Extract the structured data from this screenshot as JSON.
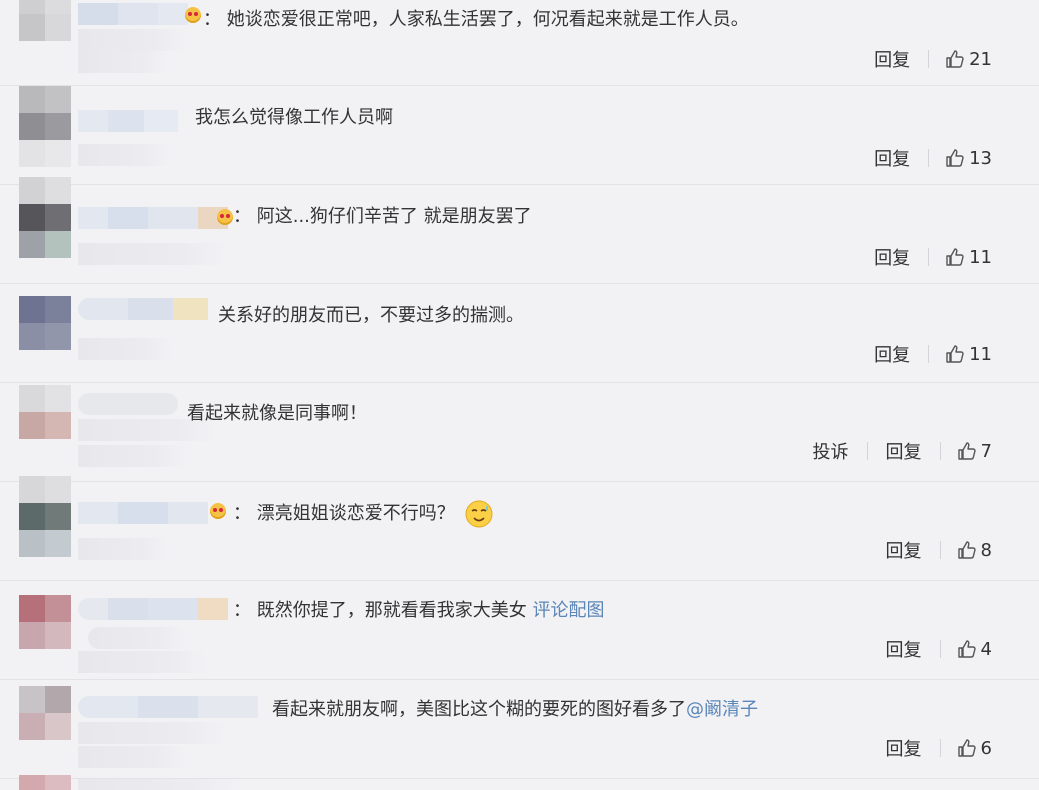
{
  "comments": [
    {
      "text": "她谈恋爱很正常吧，人家私生活罢了，何况看起来就是工作人员。",
      "actions": [
        "回复"
      ],
      "likes": "21"
    },
    {
      "text": "我怎么觉得像工作人员啊",
      "actions": [
        "回复"
      ],
      "likes": "13"
    },
    {
      "text": "阿这...狗仔们辛苦了 就是朋友罢了",
      "actions": [
        "回复"
      ],
      "likes": "11"
    },
    {
      "text": "关系好的朋友而已，不要过多的揣测。",
      "actions": [
        "回复"
      ],
      "likes": "11"
    },
    {
      "text": "看起来就像是同事啊！",
      "actions": [
        "投诉",
        "回复"
      ],
      "likes": "7"
    },
    {
      "text": "漂亮姐姐谈恋爱不行吗？",
      "actions": [
        "回复"
      ],
      "likes": "8"
    },
    {
      "text": "既然你提了，那就看看我家大美女 ",
      "link": "评论配图",
      "actions": [
        "回复"
      ],
      "likes": "4"
    },
    {
      "text": "看起来就朋友啊，美图比这个糊的要死的图好看多了",
      "link": "@阚清子",
      "actions": [
        "回复"
      ],
      "likes": "6"
    }
  ],
  "colon": "：",
  "colors": {
    "text": "#333333",
    "link": "#5a86b8",
    "background": "#f2f2f5"
  }
}
